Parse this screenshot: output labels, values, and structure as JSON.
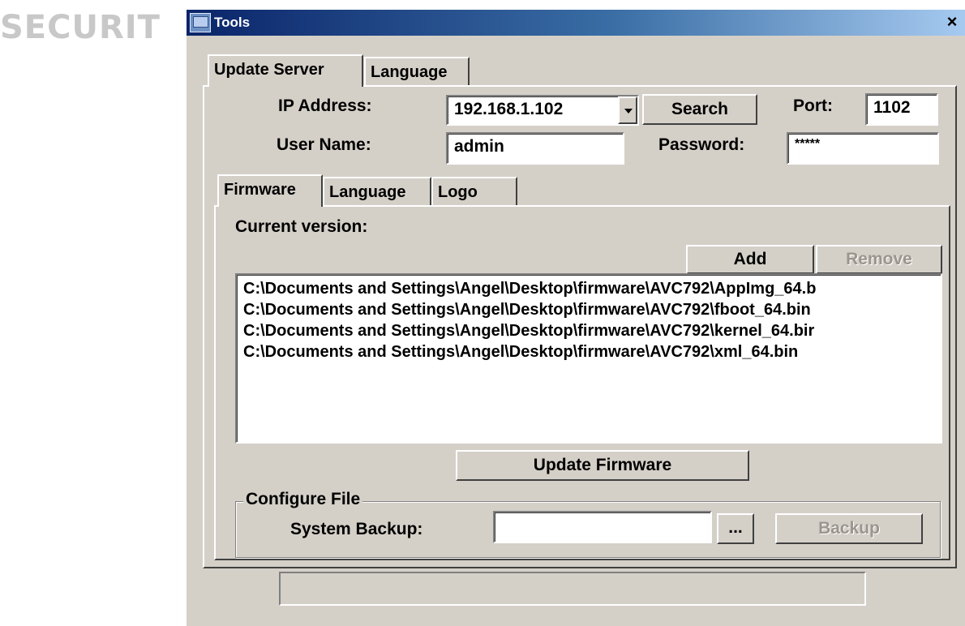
{
  "watermark": "SECURIT",
  "window": {
    "title": "Tools",
    "close_label": "×"
  },
  "outer_tabs": [
    {
      "label": "Update Server"
    },
    {
      "label": "Language"
    }
  ],
  "server": {
    "ip_label": "IP Address:",
    "ip_value": "192.168.1.102",
    "search_label": "Search",
    "port_label": "Port:",
    "port_value": "1102",
    "user_label": "User Name:",
    "user_value": "admin",
    "password_label": "Password:",
    "password_value": "*****"
  },
  "inner_tabs": [
    {
      "label": "Firmware"
    },
    {
      "label": "Language"
    },
    {
      "label": "Logo"
    }
  ],
  "firmware": {
    "current_version_label": "Current version:",
    "add_label": "Add",
    "remove_label": "Remove",
    "files": [
      "C:\\Documents and Settings\\Angel\\Desktop\\firmware\\AVC792\\AppImg_64.b",
      "C:\\Documents and Settings\\Angel\\Desktop\\firmware\\AVC792\\fboot_64.bin",
      "C:\\Documents and Settings\\Angel\\Desktop\\firmware\\AVC792\\kernel_64.bir",
      "C:\\Documents and Settings\\Angel\\Desktop\\firmware\\AVC792\\xml_64.bin"
    ],
    "update_label": "Update Firmware"
  },
  "configure": {
    "group_label": "Configure File",
    "backup_label": "System Backup:",
    "backup_path": "",
    "browse_label": "...",
    "backup_button_label": "Backup"
  },
  "status_text": ""
}
